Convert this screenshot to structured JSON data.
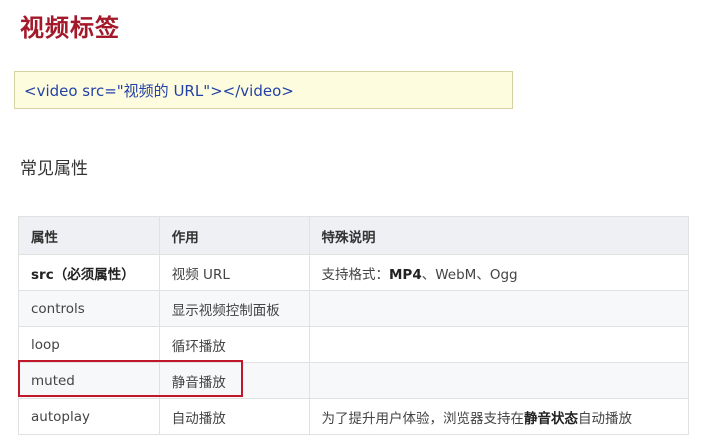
{
  "title": "视频标签",
  "code_example": "<video src=\"视频的 URL\"></video>",
  "subtitle": "常见属性",
  "table": {
    "headers": [
      "属性",
      "作用",
      "特殊说明"
    ],
    "rows": [
      {
        "attr": "src（必须属性）",
        "purpose": "视频 URL",
        "note_pre": "支持格式：",
        "note_bold": "MP4",
        "note_post": "、WebM、Ogg",
        "note_bold2": "",
        "note_post2": ""
      },
      {
        "attr": "controls",
        "purpose": "显示视频控制面板",
        "note_pre": "",
        "note_bold": "",
        "note_post": "",
        "note_bold2": "",
        "note_post2": ""
      },
      {
        "attr": "loop",
        "purpose": "循环播放",
        "note_pre": "",
        "note_bold": "",
        "note_post": "",
        "note_bold2": "",
        "note_post2": ""
      },
      {
        "attr": "muted",
        "purpose": "静音播放",
        "note_pre": "",
        "note_bold": "",
        "note_post": "",
        "note_bold2": "",
        "note_post2": ""
      },
      {
        "attr": "autoplay",
        "purpose": "自动播放",
        "note_pre": "为了提升用户体验，浏览器支持在",
        "note_bold": "静音状态",
        "note_post": "自动播放",
        "note_bold2": "",
        "note_post2": ""
      }
    ]
  },
  "colors": {
    "title": "#a3192a",
    "code_bg": "#fefcdf",
    "code_text": "#2342a5",
    "highlight_border": "#c0182a",
    "header_bg": "#eef0f4"
  }
}
